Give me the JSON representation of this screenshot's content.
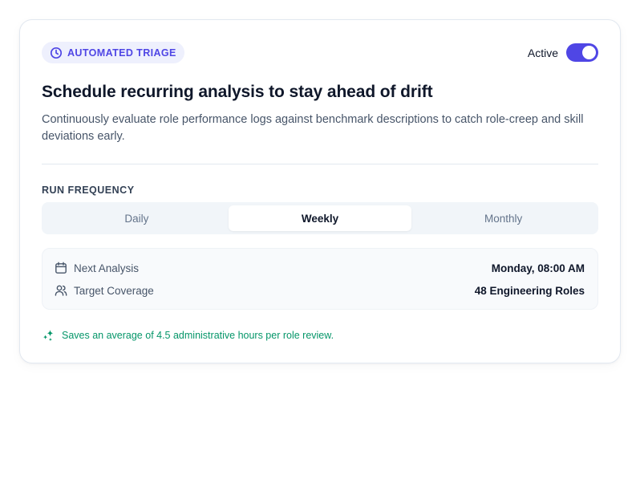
{
  "badge": {
    "label": "AUTOMATED TRIAGE",
    "icon": "clock-icon"
  },
  "toggle": {
    "label": "Active",
    "state": true
  },
  "title": "Schedule recurring analysis to stay ahead of drift",
  "description": "Continuously evaluate role performance logs against benchmark descriptions to catch role-creep and skill deviations early.",
  "frequency": {
    "label": "RUN FREQUENCY",
    "options": [
      "Daily",
      "Weekly",
      "Monthly"
    ],
    "selected": "Weekly"
  },
  "details": [
    {
      "key": "Next Analysis",
      "value": "Monday, 08:00 AM",
      "icon": "calendar-icon"
    },
    {
      "key": "Target Coverage",
      "value": "48 Engineering Roles",
      "icon": "users-icon"
    }
  ],
  "note": {
    "text": "Saves an average of 4.5 administrative hours per role review.",
    "icon": "sparkles-icon"
  },
  "colors": {
    "accent": "#4f46e5",
    "badge_bg": "#eef0fd",
    "success": "#059669"
  }
}
